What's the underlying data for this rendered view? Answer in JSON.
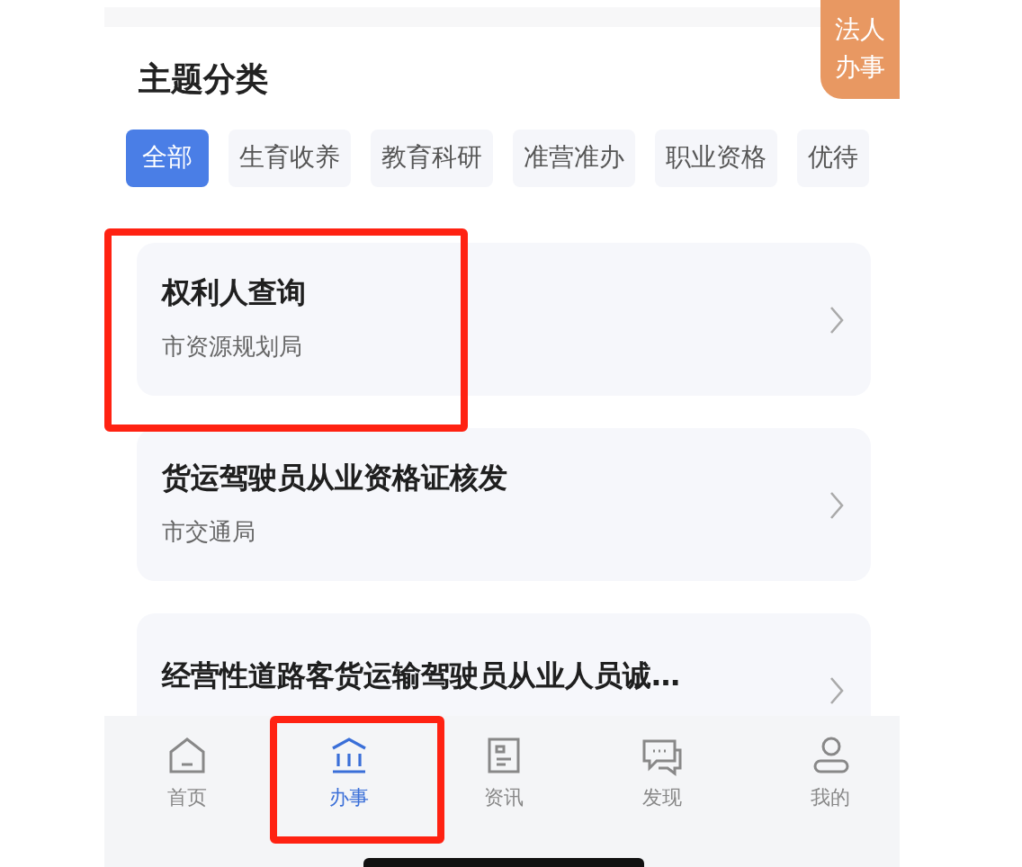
{
  "floating_badge": {
    "lines": [
      "法人",
      "办事"
    ]
  },
  "section_title": "主题分类",
  "chips": [
    {
      "label": "全部",
      "selected": true
    },
    {
      "label": "生育收养",
      "selected": false
    },
    {
      "label": "教育科研",
      "selected": false
    },
    {
      "label": "准营准办",
      "selected": false
    },
    {
      "label": "职业资格",
      "selected": false
    },
    {
      "label": "优待",
      "selected": false
    }
  ],
  "cards": [
    {
      "title": "权利人查询",
      "department": "市资源规划局",
      "highlighted": true
    },
    {
      "title": "货运驾驶员从业资格证核发",
      "department": "市交通局",
      "highlighted": false
    },
    {
      "title": "经营性道路客货运输驾驶员从业人员诚…",
      "highlighted": false
    }
  ],
  "tab_bar": [
    {
      "kind": "home",
      "label": "首页",
      "selected": false,
      "highlighted": false
    },
    {
      "kind": "service",
      "label": "办事",
      "selected": true,
      "highlighted": true
    },
    {
      "kind": "news",
      "label": "资讯",
      "selected": false,
      "highlighted": false
    },
    {
      "kind": "discover",
      "label": "发现",
      "selected": false,
      "highlighted": false
    },
    {
      "kind": "mine",
      "label": "我的",
      "selected": false,
      "highlighted": false
    }
  ]
}
